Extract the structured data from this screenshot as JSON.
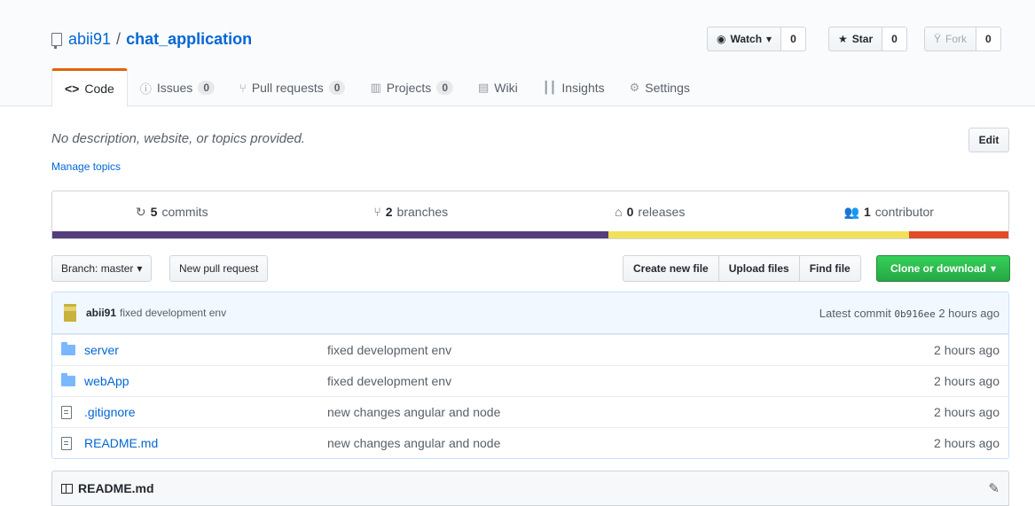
{
  "repo": {
    "owner": "abii91",
    "separator": "/",
    "name": "chat_application"
  },
  "actions": {
    "watch_label": "Watch",
    "watch_count": "0",
    "star_label": "Star",
    "star_count": "0",
    "fork_label": "Fork",
    "fork_count": "0"
  },
  "tabs": [
    {
      "label": "Code",
      "icon": "code-icon"
    },
    {
      "label": "Issues",
      "counter": "0",
      "icon": "issue-icon"
    },
    {
      "label": "Pull requests",
      "counter": "0",
      "icon": "pull-request-icon"
    },
    {
      "label": "Projects",
      "counter": "0",
      "icon": "project-icon"
    },
    {
      "label": "Wiki",
      "icon": "book-icon"
    },
    {
      "label": "Insights",
      "icon": "graph-icon"
    },
    {
      "label": "Settings",
      "icon": "gear-icon"
    }
  ],
  "description": "No description, website, or topics provided.",
  "manage_topics": "Manage topics",
  "edit_label": "Edit",
  "summary": {
    "commits_count": "5",
    "commits_label": "commits",
    "branches_count": "2",
    "branches_label": "branches",
    "releases_count": "0",
    "releases_label": "releases",
    "contributors_count": "1",
    "contributors_label": "contributor"
  },
  "languages": [
    {
      "color": "#563d7c",
      "percent": 58.2
    },
    {
      "color": "#f1e05a",
      "percent": 31.4
    },
    {
      "color": "#e34c26",
      "percent": 10.4
    }
  ],
  "toolbar": {
    "branch_label": "Branch: master",
    "new_pr_label": "New pull request",
    "create_file_label": "Create new file",
    "upload_label": "Upload files",
    "find_label": "Find file",
    "clone_label": "Clone or download"
  },
  "commit": {
    "author": "abii91",
    "message": "fixed development env",
    "latest_label": "Latest commit",
    "sha": "0b916ee",
    "time": "2 hours ago"
  },
  "files": [
    {
      "type": "folder",
      "name": "server",
      "message": "fixed development env",
      "age": "2 hours ago"
    },
    {
      "type": "folder",
      "name": "webApp",
      "message": "fixed development env",
      "age": "2 hours ago"
    },
    {
      "type": "file",
      "name": ".gitignore",
      "message": "new changes angular and node",
      "age": "2 hours ago"
    },
    {
      "type": "file",
      "name": "README.md",
      "message": "new changes angular and node",
      "age": "2 hours ago"
    }
  ],
  "readme": {
    "title": "README.md"
  },
  "colors": {
    "accent_tab": "#e36209",
    "link": "#0366d6",
    "clone_green": "#28a745"
  }
}
